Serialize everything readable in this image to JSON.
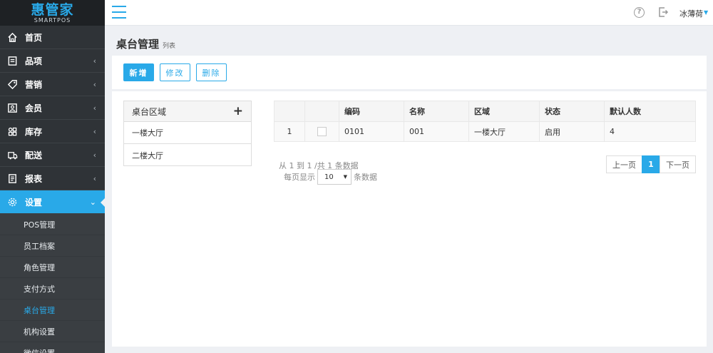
{
  "brand": {
    "name": "惠管家",
    "sub": "SMARTPOS"
  },
  "sidebar": {
    "items": [
      {
        "label": "首页",
        "icon": "home-icon",
        "has_caret": false
      },
      {
        "label": "品项",
        "icon": "document-icon",
        "has_caret": true
      },
      {
        "label": "营销",
        "icon": "tag-icon",
        "has_caret": true
      },
      {
        "label": "会员",
        "icon": "member-card-icon",
        "has_caret": true
      },
      {
        "label": "库存",
        "icon": "grid-icon",
        "has_caret": true
      },
      {
        "label": "配送",
        "icon": "delivery-icon",
        "has_caret": true
      },
      {
        "label": "报表",
        "icon": "report-icon",
        "has_caret": true
      },
      {
        "label": "设置",
        "icon": "gear-icon",
        "has_caret": true,
        "active": true
      }
    ],
    "sub_items": [
      "POS管理",
      "员工档案",
      "角色管理",
      "支付方式",
      "桌台管理",
      "机构设置",
      "微信设置"
    ],
    "active_sub": "桌台管理"
  },
  "header": {
    "user": "冰薄荷"
  },
  "page": {
    "title": "桌台管理",
    "subtitle": "列表"
  },
  "toolbar": {
    "add_label": "新增",
    "edit_label": "修改",
    "delete_label": "删除"
  },
  "area_panel": {
    "title": "桌台区域",
    "add_symbol": "+",
    "areas": [
      "一楼大厅",
      "二楼大厅"
    ]
  },
  "table": {
    "columns": [
      "",
      "",
      "编码",
      "名称",
      "区域",
      "状态",
      "默认人数"
    ],
    "rows": [
      {
        "index": "1",
        "code": "0101",
        "name": "001",
        "area": "一楼大厅",
        "status": "启用",
        "default_people": "4"
      }
    ]
  },
  "pager": {
    "info": "从 1 到 1 /共 1 条数据",
    "per_page_prefix": "每页显示",
    "per_page_value": "10",
    "per_page_suffix": "条数据",
    "prev": "上一页",
    "current": "1",
    "next": "下一页"
  },
  "colors": {
    "accent": "#29a9e8",
    "sidebar_bg": "#2f3337"
  }
}
